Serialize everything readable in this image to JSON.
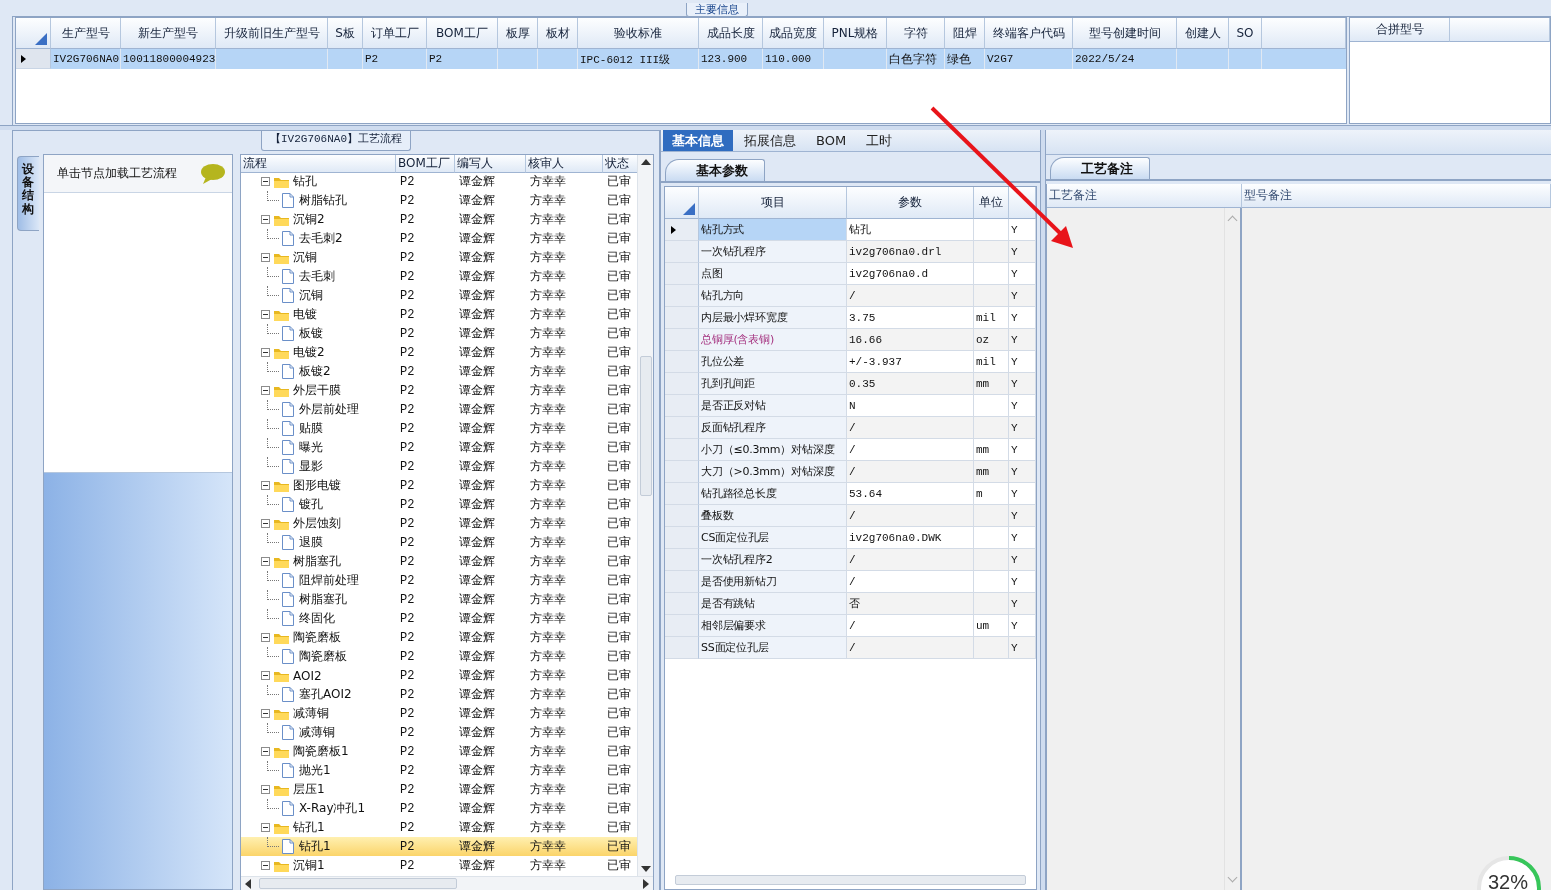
{
  "main_info": {
    "title": "主要信息",
    "columns": [
      "生产型号",
      "新生产型号",
      "升级前旧生产型号",
      "S板",
      "订单工厂",
      "BOM工厂",
      "板厚",
      "板材",
      "验收标准",
      "成品长度",
      "成品宽度",
      "PNL规格",
      "字符",
      "阻焊",
      "终端客户代码",
      "型号创建时间",
      "创建人",
      "SO"
    ],
    "rows": [
      {
        "selected": true,
        "cells": [
          "IV2G706NA0",
          "10011800004923",
          null,
          null,
          "P2",
          "P2",
          null,
          null,
          "IPC-6012 III级",
          "123.900",
          "110.000",
          null,
          "白色字符",
          "绿色",
          "V2G7",
          "2022/5/24",
          null,
          null
        ]
      }
    ],
    "merge_columns": [
      "合拼型号"
    ]
  },
  "process_panel": {
    "title": "【IV2G706NA0】工艺流程",
    "side_tab": "设备结构",
    "hint": "单击节点加载工艺流程",
    "columns": [
      "流程",
      "BOM工厂",
      "编写人",
      "核审人",
      "状态"
    ],
    "tree": [
      {
        "kind": "group",
        "label": "钻孔",
        "bom": "P2",
        "writer": "谭金辉",
        "reviewer": "方幸幸",
        "status": "已审",
        "expanded": true,
        "selected": false,
        "children": [
          {
            "kind": "step",
            "label": "树脂钻孔",
            "bom": "P2",
            "writer": "谭金辉",
            "reviewer": "方幸幸",
            "status": "已审",
            "selected": false
          }
        ]
      },
      {
        "kind": "group",
        "label": "沉铜2",
        "bom": "P2",
        "writer": "谭金辉",
        "reviewer": "方幸幸",
        "status": "已审",
        "expanded": true,
        "selected": false,
        "children": [
          {
            "kind": "step",
            "label": "去毛刺2",
            "bom": "P2",
            "writer": "谭金辉",
            "reviewer": "方幸幸",
            "status": "已审",
            "selected": false
          }
        ]
      },
      {
        "kind": "group",
        "label": "沉铜",
        "bom": "P2",
        "writer": "谭金辉",
        "reviewer": "方幸幸",
        "status": "已审",
        "expanded": true,
        "selected": false,
        "children": [
          {
            "kind": "step",
            "label": "去毛刺",
            "bom": "P2",
            "writer": "谭金辉",
            "reviewer": "方幸幸",
            "status": "已审",
            "selected": false
          },
          {
            "kind": "step",
            "label": "沉铜",
            "bom": "P2",
            "writer": "谭金辉",
            "reviewer": "方幸幸",
            "status": "已审",
            "selected": false
          }
        ]
      },
      {
        "kind": "group",
        "label": "电镀",
        "bom": "P2",
        "writer": "谭金辉",
        "reviewer": "方幸幸",
        "status": "已审",
        "expanded": true,
        "selected": false,
        "children": [
          {
            "kind": "step",
            "label": "板镀",
            "bom": "P2",
            "writer": "谭金辉",
            "reviewer": "方幸幸",
            "status": "已审",
            "selected": false
          }
        ]
      },
      {
        "kind": "group",
        "label": "电镀2",
        "bom": "P2",
        "writer": "谭金辉",
        "reviewer": "方幸幸",
        "status": "已审",
        "expanded": true,
        "selected": false,
        "children": [
          {
            "kind": "step",
            "label": "板镀2",
            "bom": "P2",
            "writer": "谭金辉",
            "reviewer": "方幸幸",
            "status": "已审",
            "selected": false
          }
        ]
      },
      {
        "kind": "group",
        "label": "外层干膜",
        "bom": "P2",
        "writer": "谭金辉",
        "reviewer": "方幸幸",
        "status": "已审",
        "expanded": true,
        "selected": false,
        "children": [
          {
            "kind": "step",
            "label": "外层前处理",
            "bom": "P2",
            "writer": "谭金辉",
            "reviewer": "方幸幸",
            "status": "已审",
            "selected": false
          },
          {
            "kind": "step",
            "label": "贴膜",
            "bom": "P2",
            "writer": "谭金辉",
            "reviewer": "方幸幸",
            "status": "已审",
            "selected": false
          },
          {
            "kind": "step",
            "label": "曝光",
            "bom": "P2",
            "writer": "谭金辉",
            "reviewer": "方幸幸",
            "status": "已审",
            "selected": false
          },
          {
            "kind": "step",
            "label": "显影",
            "bom": "P2",
            "writer": "谭金辉",
            "reviewer": "方幸幸",
            "status": "已审",
            "selected": false
          }
        ]
      },
      {
        "kind": "group",
        "label": "图形电镀",
        "bom": "P2",
        "writer": "谭金辉",
        "reviewer": "方幸幸",
        "status": "已审",
        "expanded": true,
        "selected": false,
        "children": [
          {
            "kind": "step",
            "label": "镀孔",
            "bom": "P2",
            "writer": "谭金辉",
            "reviewer": "方幸幸",
            "status": "已审",
            "selected": false
          }
        ]
      },
      {
        "kind": "group",
        "label": "外层蚀刻",
        "bom": "P2",
        "writer": "谭金辉",
        "reviewer": "方幸幸",
        "status": "已审",
        "expanded": true,
        "selected": false,
        "children": [
          {
            "kind": "step",
            "label": "退膜",
            "bom": "P2",
            "writer": "谭金辉",
            "reviewer": "方幸幸",
            "status": "已审",
            "selected": false
          }
        ]
      },
      {
        "kind": "group",
        "label": "树脂塞孔",
        "bom": "P2",
        "writer": "谭金辉",
        "reviewer": "方幸幸",
        "status": "已审",
        "expanded": true,
        "selected": false,
        "children": [
          {
            "kind": "step",
            "label": "阻焊前处理",
            "bom": "P2",
            "writer": "谭金辉",
            "reviewer": "方幸幸",
            "status": "已审",
            "selected": false
          },
          {
            "kind": "step",
            "label": "树脂塞孔",
            "bom": "P2",
            "writer": "谭金辉",
            "reviewer": "方幸幸",
            "status": "已审",
            "selected": false
          },
          {
            "kind": "step",
            "label": "终固化",
            "bom": "P2",
            "writer": "谭金辉",
            "reviewer": "方幸幸",
            "status": "已审",
            "selected": false
          }
        ]
      },
      {
        "kind": "group",
        "label": "陶瓷磨板",
        "bom": "P2",
        "writer": "谭金辉",
        "reviewer": "方幸幸",
        "status": "已审",
        "expanded": true,
        "selected": false,
        "children": [
          {
            "kind": "step",
            "label": "陶瓷磨板",
            "bom": "P2",
            "writer": "谭金辉",
            "reviewer": "方幸幸",
            "status": "已审",
            "selected": false
          }
        ]
      },
      {
        "kind": "group",
        "label": "AOI2",
        "bom": "P2",
        "writer": "谭金辉",
        "reviewer": "方幸幸",
        "status": "已审",
        "expanded": true,
        "selected": false,
        "children": [
          {
            "kind": "step",
            "label": "塞孔AOI2",
            "bom": "P2",
            "writer": "谭金辉",
            "reviewer": "方幸幸",
            "status": "已审",
            "selected": false
          }
        ]
      },
      {
        "kind": "group",
        "label": "减薄铜",
        "bom": "P2",
        "writer": "谭金辉",
        "reviewer": "方幸幸",
        "status": "已审",
        "expanded": true,
        "selected": false,
        "children": [
          {
            "kind": "step",
            "label": "减薄铜",
            "bom": "P2",
            "writer": "谭金辉",
            "reviewer": "方幸幸",
            "status": "已审",
            "selected": false
          }
        ]
      },
      {
        "kind": "group",
        "label": "陶瓷磨板1",
        "bom": "P2",
        "writer": "谭金辉",
        "reviewer": "方幸幸",
        "status": "已审",
        "expanded": true,
        "selected": false,
        "children": [
          {
            "kind": "step",
            "label": "抛光1",
            "bom": "P2",
            "writer": "谭金辉",
            "reviewer": "方幸幸",
            "status": "已审",
            "selected": false
          }
        ]
      },
      {
        "kind": "group",
        "label": "层压1",
        "bom": "P2",
        "writer": "谭金辉",
        "reviewer": "方幸幸",
        "status": "已审",
        "expanded": true,
        "selected": false,
        "children": [
          {
            "kind": "step",
            "label": "X-Ray冲孔1",
            "bom": "P2",
            "writer": "谭金辉",
            "reviewer": "方幸幸",
            "status": "已审",
            "selected": false
          }
        ]
      },
      {
        "kind": "group",
        "label": "钻孔1",
        "bom": "P2",
        "writer": "谭金辉",
        "reviewer": "方幸幸",
        "status": "已审",
        "expanded": true,
        "selected": false,
        "children": [
          {
            "kind": "step",
            "label": "钻孔1",
            "bom": "P2",
            "writer": "谭金辉",
            "reviewer": "方幸幸",
            "status": "已审",
            "selected": true
          }
        ]
      },
      {
        "kind": "group",
        "label": "沉铜1",
        "bom": "P2",
        "writer": "谭金辉",
        "reviewer": "方幸幸",
        "status": "已审",
        "expanded": true,
        "selected": false
      }
    ]
  },
  "detail_tabs": [
    {
      "label": "基本信息",
      "selected": true
    },
    {
      "label": "拓展信息",
      "selected": false
    },
    {
      "label": "BOM",
      "selected": false
    },
    {
      "label": "工时",
      "selected": false
    }
  ],
  "params": {
    "tab": "基本参数",
    "columns": [
      "项目",
      "参数",
      "单位"
    ],
    "rows": [
      {
        "item": "钻孔方式",
        "value": "钻孔",
        "flag": "Y",
        "selected": true,
        "highlighted": false
      },
      {
        "item": "一次钻孔程序",
        "value": "iv2g706na0.drl",
        "flag": "Y",
        "selected": false,
        "highlighted": false
      },
      {
        "item": "点图",
        "value": "iv2g706na0.d",
        "flag": "Y",
        "selected": false,
        "highlighted": false
      },
      {
        "item": "钻孔方向",
        "value": "/",
        "flag": "Y",
        "selected": false,
        "highlighted": false
      },
      {
        "item": "内层最小焊环宽度",
        "value": "3.75",
        "unit": "mil",
        "flag": "Y",
        "selected": false,
        "highlighted": false
      },
      {
        "item": "总铜厚(含表铜)",
        "value": "16.66",
        "unit": "oz",
        "flag": "Y",
        "selected": false,
        "highlighted": true
      },
      {
        "item": "孔位公差",
        "value": "+/-3.937",
        "unit": "mil",
        "flag": "Y",
        "selected": false,
        "highlighted": false
      },
      {
        "item": "孔到孔间距",
        "value": "0.35",
        "unit": "mm",
        "flag": "Y",
        "selected": false,
        "highlighted": false
      },
      {
        "item": "是否正反对钻",
        "value": "N",
        "flag": "Y",
        "selected": false,
        "highlighted": false
      },
      {
        "item": "反面钻孔程序",
        "value": "/",
        "flag": "Y",
        "selected": false,
        "highlighted": false
      },
      {
        "item": "小刀（≤0.3mm）对钻深度",
        "value": "/",
        "unit": "mm",
        "flag": "Y",
        "selected": false,
        "highlighted": false
      },
      {
        "item": "大刀（>0.3mm）对钻深度",
        "value": "/",
        "unit": "mm",
        "flag": "Y",
        "selected": false,
        "highlighted": false
      },
      {
        "item": "钻孔路径总长度",
        "value": "53.64",
        "unit": "m",
        "flag": "Y",
        "selected": false,
        "highlighted": false
      },
      {
        "item": "叠板数",
        "value": "/",
        "flag": "Y",
        "selected": false,
        "highlighted": false
      },
      {
        "item": "CS面定位孔层",
        "value": "iv2g706na0.DWK",
        "flag": "Y",
        "selected": false,
        "highlighted": false
      },
      {
        "item": "一次钻孔程序2",
        "value": "/",
        "flag": "Y",
        "selected": false,
        "highlighted": false
      },
      {
        "item": "是否使用新钻刀",
        "value": "/",
        "flag": "Y",
        "selected": false,
        "highlighted": false
      },
      {
        "item": "是否有跳钻",
        "value": "否",
        "flag": "Y",
        "selected": false,
        "highlighted": false
      },
      {
        "item": "相邻层偏要求",
        "value": "/",
        "unit": "um",
        "flag": "Y",
        "selected": false,
        "highlighted": false
      },
      {
        "item": "SS面定位孔层",
        "value": "/",
        "flag": "Y",
        "selected": false,
        "highlighted": false
      }
    ]
  },
  "notes": {
    "tab": "工艺备注",
    "columns": [
      "工艺备注",
      "型号备注"
    ]
  },
  "progress": {
    "level": 0.32,
    "text": "32%"
  }
}
